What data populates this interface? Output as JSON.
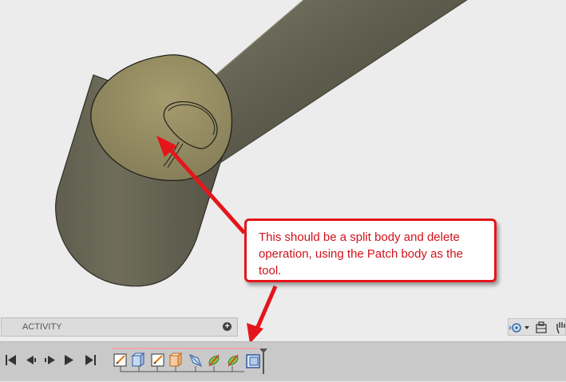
{
  "callout": {
    "text": "This should be a split body and delete operation, using the Patch body as the tool."
  },
  "activity_panel": {
    "label": "ACTIVITY",
    "expand_icon": "plus-circle-icon"
  },
  "playback_controls": [
    {
      "name": "first",
      "icon": "skip-to-start-icon"
    },
    {
      "name": "previous",
      "icon": "step-back-icon"
    },
    {
      "name": "play",
      "icon": "play-icon"
    },
    {
      "name": "next",
      "icon": "step-forward-icon"
    },
    {
      "name": "last",
      "icon": "skip-to-end-icon"
    }
  ],
  "timeline_features": [
    {
      "type": "sketch",
      "icon": "sketch-icon"
    },
    {
      "type": "extrude",
      "icon": "extrude-icon"
    },
    {
      "type": "sketch",
      "icon": "sketch-icon"
    },
    {
      "type": "extrude",
      "icon": "extrude-icon"
    },
    {
      "type": "patch",
      "icon": "patch-surface-icon"
    },
    {
      "type": "sweep",
      "icon": "sweep-icon"
    },
    {
      "type": "sweep",
      "icon": "sweep-icon"
    },
    {
      "type": "split-body",
      "icon": "split-body-icon"
    }
  ],
  "nav_tools": [
    {
      "name": "orbit",
      "icon": "orbit-icon"
    },
    {
      "name": "look-at",
      "icon": "look-at-icon"
    },
    {
      "name": "pan",
      "icon": "pan-hand-icon"
    }
  ],
  "colors": {
    "callout_red": "#e4161b",
    "body_gray": "#6b6a55",
    "cap_tan": "#958c64"
  }
}
